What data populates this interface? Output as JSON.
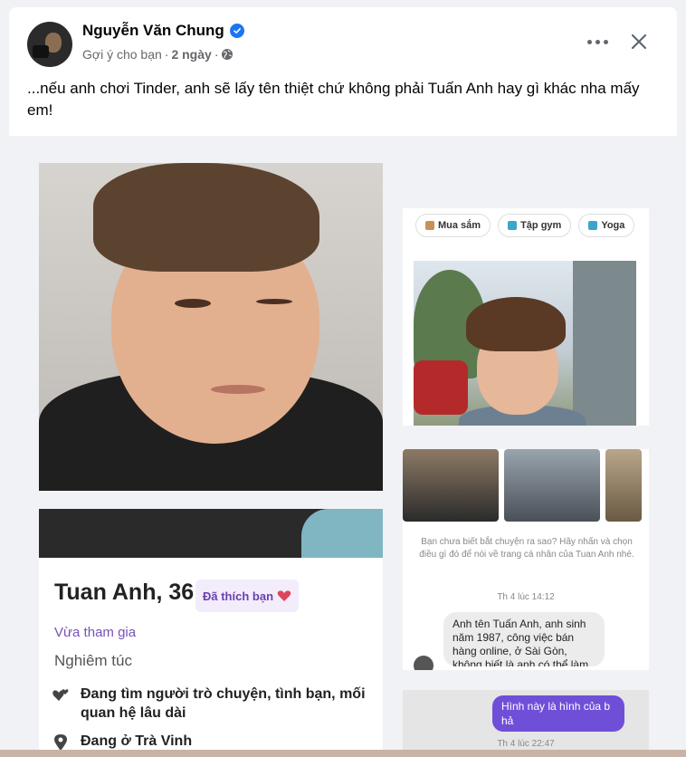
{
  "post": {
    "author": "Nguyễn Văn Chung",
    "suggestion": "Gợi ý cho bạn",
    "separator": "·",
    "time": "2 ngày",
    "text": "...nếu anh chơi Tinder, anh sẽ lấy tên thiệt chứ không phải Tuấn Anh hay gì khác nha mấy em!"
  },
  "icons": {
    "verified": "verified-badge-icon",
    "globe": "globe-icon",
    "more": "more-icon",
    "close": "close-icon"
  },
  "colors": {
    "brand_blue": "#1877f2",
    "tinder_purple": "#6f4fd8"
  },
  "profile": {
    "name_age": "Tuan Anh, 36",
    "liked_badge": "Đã thích bạn",
    "joined": "Vừa tham gia",
    "intent": "Nghiêm túc",
    "seeking": "Đang tìm người trò chuyện, tình bạn, mối quan hệ lâu dài",
    "location": "Đang ở Trà Vinh"
  },
  "interests": [
    {
      "label": "Mua sắm",
      "color": "#c7905a"
    },
    {
      "label": "Tập gym",
      "color": "#3aa6c9"
    },
    {
      "label": "Yoga",
      "color": "#3aa6c9"
    }
  ],
  "chat": {
    "hint": "Bạn chưa biết bắt chuyện ra sao? Hãy nhấn và chọn điều gì đó để nói về trang cá nhân của Tuan Anh nhé.",
    "time1": "Th 4 lúc 14:12",
    "incoming": "Anh tên Tuấn Anh, anh sinh năm 1987, công việc bán hàng online, ở Sài Gòn, không biết là anh có thể làm",
    "outgoing": "Hình này là hình của b hả",
    "time2": "Th 4 lúc 22:47"
  }
}
